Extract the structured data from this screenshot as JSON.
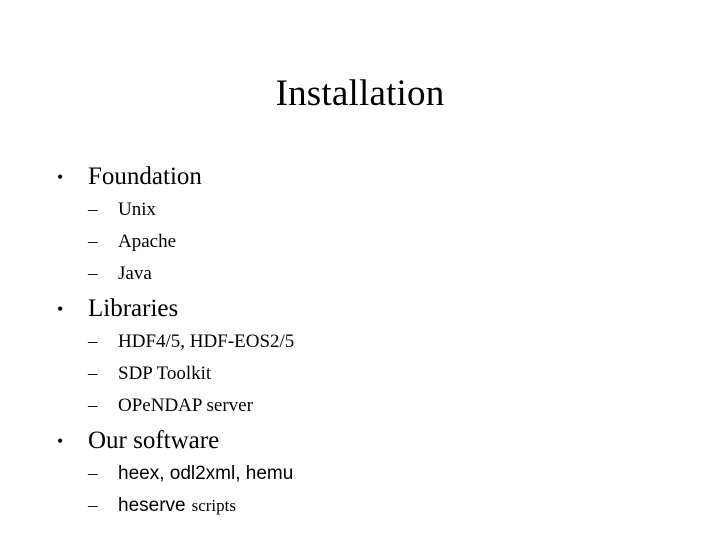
{
  "slide": {
    "title": "Installation",
    "bullet_glyph": "•",
    "dash_glyph": "–",
    "background_color": "#ffffff",
    "text_color": "#000000",
    "sections": [
      {
        "heading": "Foundation",
        "items": [
          {
            "text": "Unix",
            "style": "serif"
          },
          {
            "text": "Apache",
            "style": "serif"
          },
          {
            "text": "Java",
            "style": "serif"
          }
        ]
      },
      {
        "heading": "Libraries",
        "items": [
          {
            "text": "HDF4/5, HDF-EOS2/5",
            "style": "serif"
          },
          {
            "text": "SDP Toolkit",
            "style": "serif"
          },
          {
            "text": "OPeNDAP server",
            "style": "serif"
          }
        ]
      },
      {
        "heading": "Our software",
        "items": [
          {
            "text": "heex, odl2xml, hemu",
            "style": "sans"
          },
          {
            "text": "heserve",
            "suffix": "scripts",
            "style": "sans-mixed"
          }
        ]
      }
    ]
  }
}
